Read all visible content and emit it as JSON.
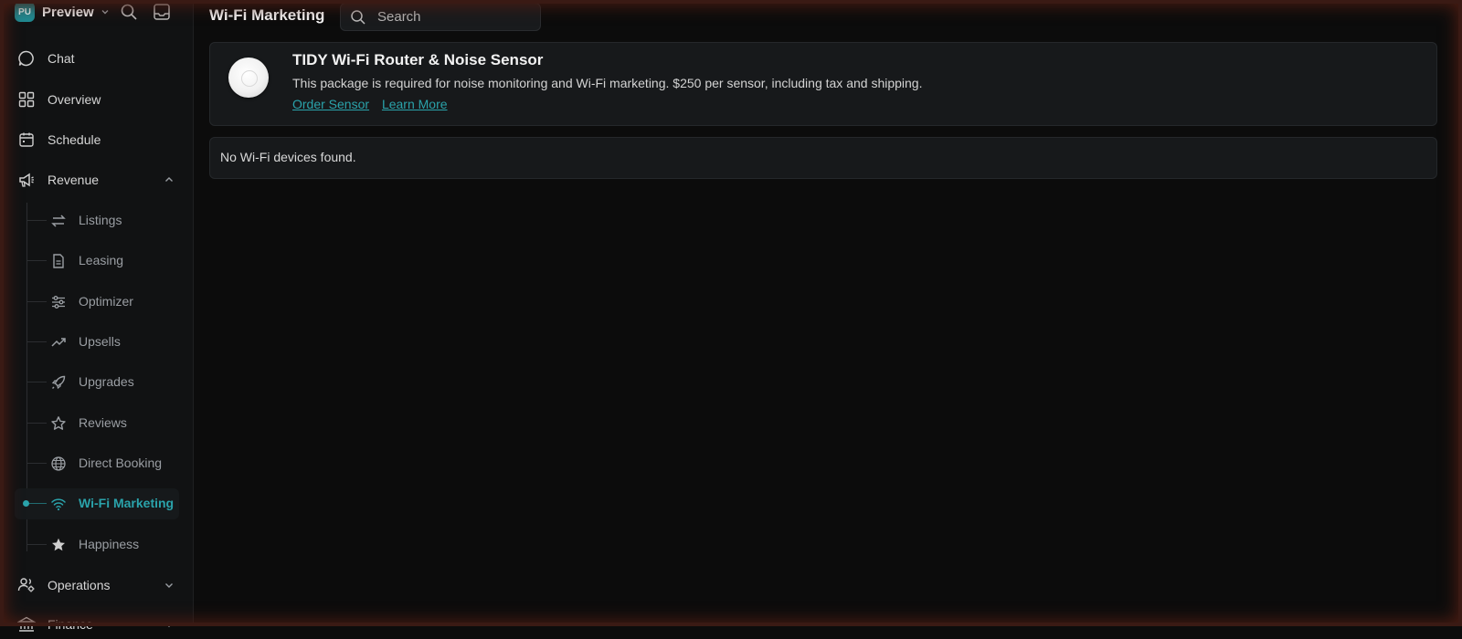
{
  "workspace": {
    "initials": "PU",
    "name": "Preview"
  },
  "nav": {
    "chat": "Chat",
    "overview": "Overview",
    "schedule": "Schedule",
    "revenue": "Revenue",
    "operations": "Operations",
    "finance": "Finance"
  },
  "revenue_items": [
    {
      "label": "Listings",
      "icon": "arrows-swap-icon"
    },
    {
      "label": "Leasing",
      "icon": "document-icon"
    },
    {
      "label": "Optimizer",
      "icon": "sliders-icon"
    },
    {
      "label": "Upsells",
      "icon": "trending-up-icon"
    },
    {
      "label": "Upgrades",
      "icon": "rocket-icon"
    },
    {
      "label": "Reviews",
      "icon": "star-outline-icon"
    },
    {
      "label": "Direct Booking",
      "icon": "globe-icon"
    },
    {
      "label": "Wi-Fi Marketing",
      "icon": "wifi-icon"
    },
    {
      "label": "Happiness",
      "icon": "star-filled-icon"
    }
  ],
  "active_item": "Wi-Fi Marketing",
  "header": {
    "title": "Wi-Fi Marketing",
    "search_placeholder": "Search"
  },
  "product_card": {
    "title": "TIDY Wi-Fi Router & Noise Sensor",
    "description": "This package is required for noise monitoring and Wi-Fi marketing. $250 per sensor, including tax and shipping.",
    "order_link": "Order Sensor",
    "learn_link": "Learn More"
  },
  "empty_state": "No Wi-Fi devices found.",
  "colors": {
    "accent": "#2aa3ab",
    "background": "#0c0c0c",
    "sidebar": "#111213",
    "card": "#17191b"
  }
}
